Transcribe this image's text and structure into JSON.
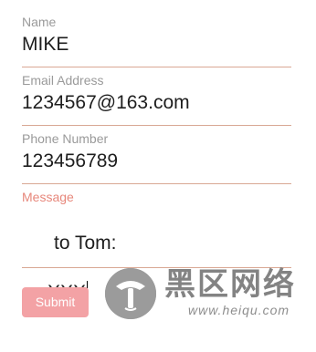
{
  "form": {
    "name": {
      "label": "Name",
      "value": "MIKE"
    },
    "email": {
      "label": "Email Address",
      "value": "1234567@163.com"
    },
    "phone": {
      "label": "Phone Number",
      "value": "123456789"
    },
    "message": {
      "label": "Message",
      "line1": "to Tom:",
      "line2": "XXX"
    },
    "submit_label": "Submit"
  },
  "watermark": {
    "chinese_text": "黑区网络",
    "url": "www.heiqu.com"
  },
  "colors": {
    "label": "#9a9a9a",
    "active_label": "#e7877b",
    "underline": "#d9a894",
    "submit_bg": "#f3a2a5",
    "submit_text": "#ffffff"
  }
}
